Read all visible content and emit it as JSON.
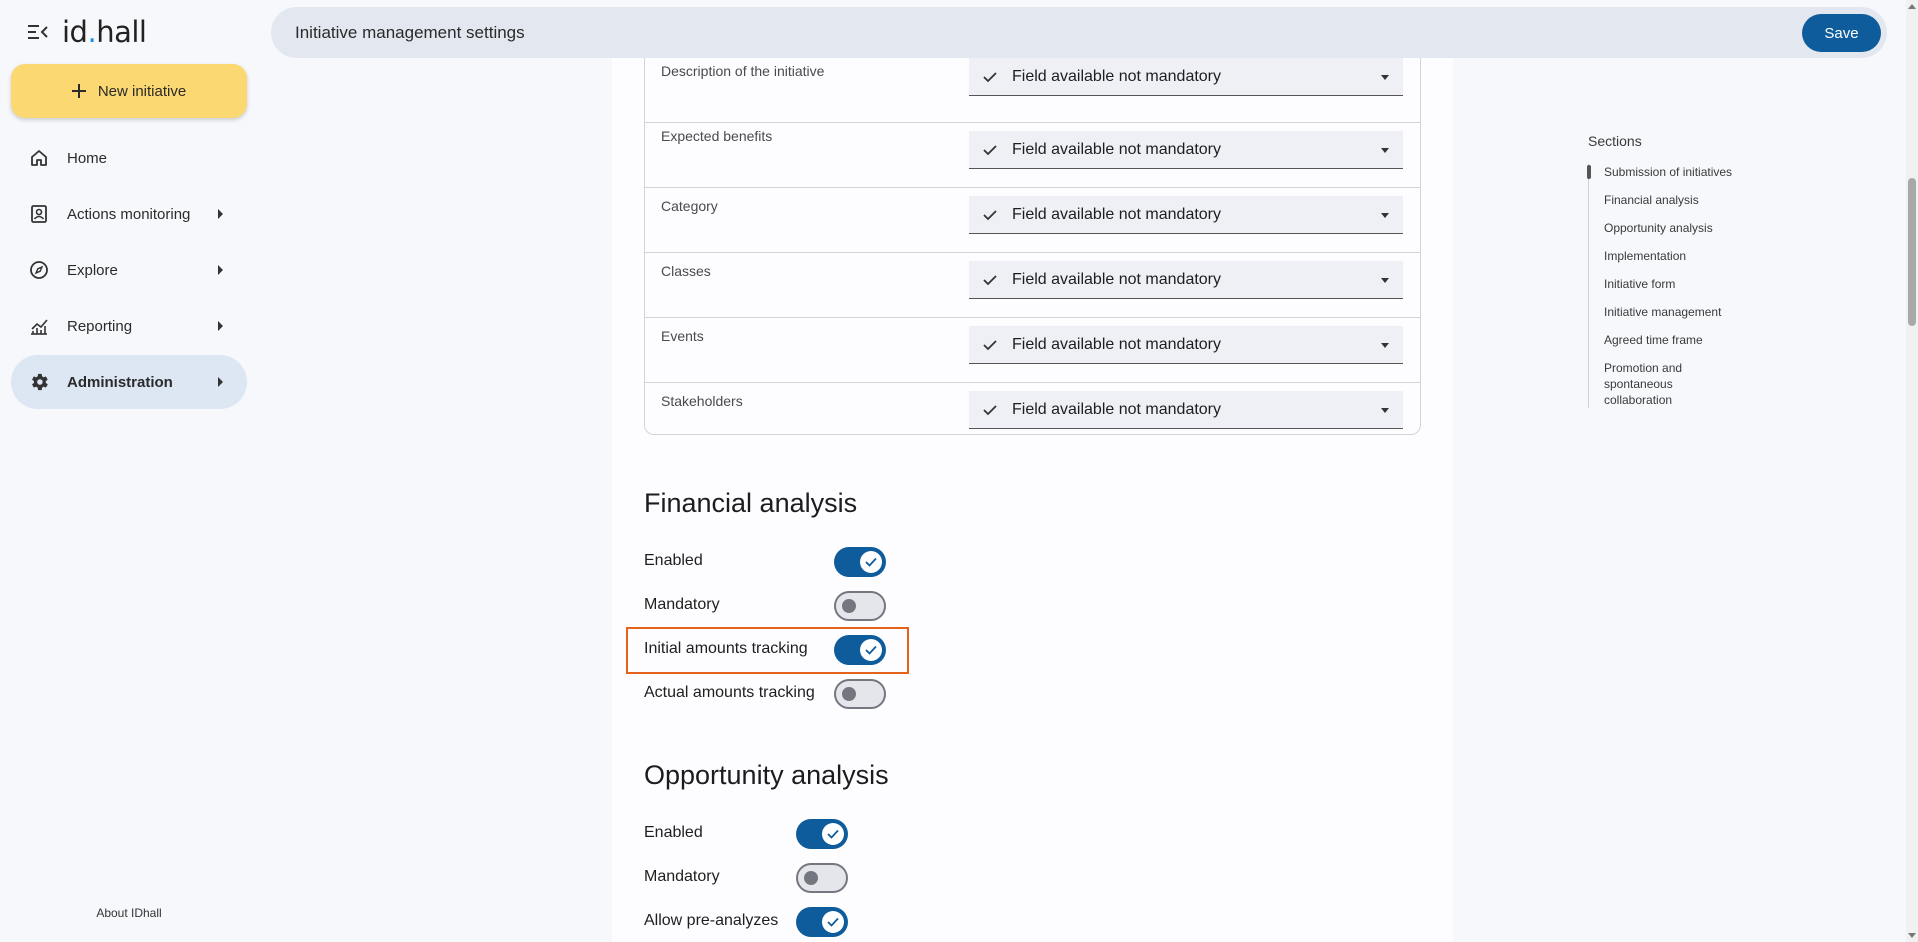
{
  "app": {
    "logo_text": "id",
    "logo_dot": ".",
    "logo_text2": "hall",
    "menu_icon": "menu-collapse-icon"
  },
  "sidebar": {
    "new_button": "New initiative",
    "items": [
      {
        "label": "Home",
        "icon": "home-icon"
      },
      {
        "label": "Actions monitoring",
        "icon": "clipboard-user-icon"
      },
      {
        "label": "Explore",
        "icon": "compass-icon"
      },
      {
        "label": "Reporting",
        "icon": "chart-icon"
      },
      {
        "label": "Administration",
        "icon": "gear-icon"
      }
    ],
    "about": "About IDhall"
  },
  "header": {
    "title": "Initiative management settings",
    "save_label": "Save"
  },
  "fields": [
    {
      "label": "Description of the initiative",
      "value": "Field available not mandatory"
    },
    {
      "label": "Expected benefits",
      "value": "Field available not mandatory"
    },
    {
      "label": "Category",
      "value": "Field available not mandatory"
    },
    {
      "label": "Classes",
      "value": "Field available not mandatory"
    },
    {
      "label": "Events",
      "value": "Field available not mandatory"
    },
    {
      "label": "Stakeholders",
      "value": "Field available not mandatory"
    }
  ],
  "financial": {
    "title": "Financial analysis",
    "toggles": [
      {
        "label": "Enabled",
        "on": true
      },
      {
        "label": "Mandatory",
        "on": false
      },
      {
        "label": "Initial amounts tracking",
        "on": true
      },
      {
        "label": "Actual amounts tracking",
        "on": false
      }
    ]
  },
  "opportunity": {
    "title": "Opportunity analysis",
    "toggles": [
      {
        "label": "Enabled",
        "on": true
      },
      {
        "label": "Mandatory",
        "on": false
      },
      {
        "label": "Allow pre-analyzes",
        "on": true
      }
    ]
  },
  "sections_nav": {
    "title": "Sections",
    "items": [
      "Submission of initiatives",
      "Financial analysis",
      "Opportunity analysis",
      "Implementation",
      "Initiative form",
      "Initiative management",
      "Agreed time frame",
      "Promotion and spontaneous collaboration"
    ]
  },
  "colors": {
    "accent": "#0f5c9c",
    "new_button": "#fbd872",
    "highlight": "#e3621c"
  }
}
